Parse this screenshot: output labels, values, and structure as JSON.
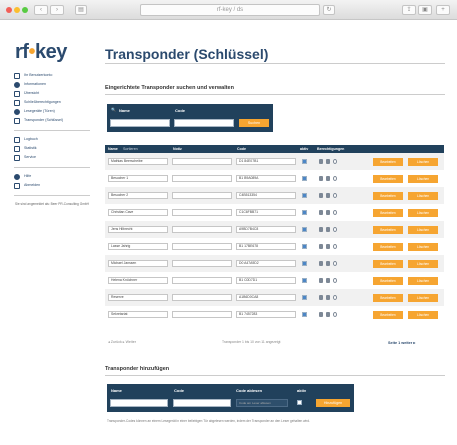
{
  "browser": {
    "url": "rf-key / ds",
    "back": "‹",
    "forward": "›",
    "reload": "↻",
    "share": "⇪",
    "tabs": "▣",
    "sidebar_toggle": "▤"
  },
  "logo": {
    "prefix": "rf",
    "accent": "•",
    "suffix": "key"
  },
  "page": {
    "title": "Transponder (Schlüssel)"
  },
  "sidebar": {
    "items": [
      {
        "label": "Ihr Benutzerkonto",
        "icon": "user-icon"
      },
      {
        "label": "Informationen",
        "icon": "info-icon"
      },
      {
        "label": "Übersicht",
        "icon": "overview-icon"
      },
      {
        "label": "Schließberechtigungen",
        "icon": "calendar-icon"
      },
      {
        "label": "Lesegeräte (Türen)",
        "icon": "location-icon"
      },
      {
        "label": "Transponder (Schlüssel)",
        "icon": "key-icon"
      }
    ],
    "items2": [
      {
        "label": "Logbuch",
        "icon": "log-icon"
      },
      {
        "label": "Statistik",
        "icon": "chart-icon"
      },
      {
        "label": "Service",
        "icon": "wrench-icon"
      }
    ],
    "items3": [
      {
        "label": "Hilfe",
        "icon": "help-icon"
      },
      {
        "label": "Abmelden",
        "icon": "logout-icon"
      }
    ],
    "footer": "Sie sind angemeldet als: Beer PR-Consulting GmbH"
  },
  "search_section": {
    "title": "Eingerichtete Transponder suchen und verwalten",
    "name_label": "Name",
    "code_label": "Code",
    "button": "Suchen"
  },
  "table": {
    "headers": {
      "name": "Name",
      "sort": "Sortieren",
      "notes": "Notiz",
      "code": "Code",
      "active": "aktiv",
      "perms": "Berechtigungen"
    },
    "rows": [
      {
        "name": "Mathias Beerscheibe",
        "code": "D1 84E07B1"
      },
      {
        "name": "Besucher 1",
        "code": "B1 B9A089A"
      },
      {
        "name": "Besucher 2",
        "code": "C4B513354"
      },
      {
        "name": "Christian Cave",
        "code": "C1C6FBB71"
      },
      {
        "name": "Jens Hilbrecht",
        "code": "A9BD7B4C8"
      },
      {
        "name": "Lasse Jahrig",
        "code": "B1 17BE678"
      },
      {
        "name": "Michael Janssen",
        "code": "D0 A47A9D2"
      },
      {
        "name": "Helena Knöchner",
        "code": "B1 C0D7D1"
      },
      {
        "name": "Reserve",
        "code": "A1B6D0CA8"
      },
      {
        "name": "Sekretariat",
        "code": "B1 7457283"
      }
    ],
    "btn_edit": "Bearbeiten",
    "btn_delete": "Löschen"
  },
  "pager": {
    "left": "◂ Zurück  ▸ Weiter",
    "mid": "Transponder 1 bis 10 von 11 angezeigt",
    "right": "Seite 1   weiter ▸"
  },
  "add_section": {
    "title": "Transponder hinzufügen",
    "name_label": "Name",
    "code_label": "Code",
    "code_manual_label": "Code ablesen",
    "active_label": "aktiv",
    "code_placeholder": "Code am Leser ablesen",
    "button": "Hinzufügen"
  },
  "note": "Transponder-Codes können an einem Lesegerät in einer beliebigen Tür abgelesen werden, indem der Transponder an den Leser gehalten wird."
}
